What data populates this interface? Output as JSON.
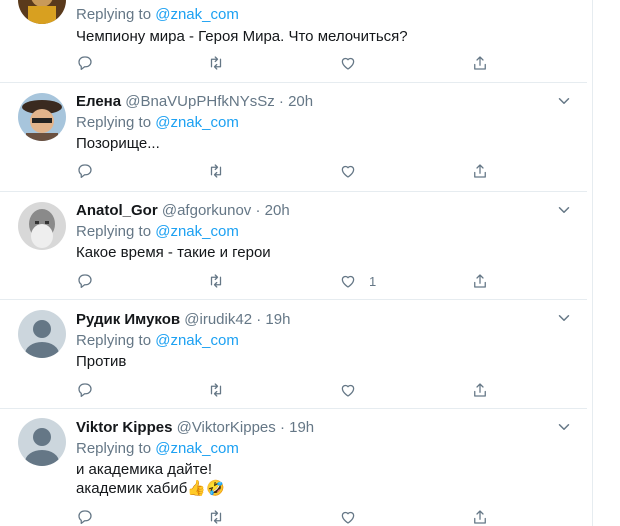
{
  "tweets": [
    {
      "name": "",
      "handle": "",
      "time": "",
      "replying_prefix": "Replying to ",
      "mention": "@znak_com",
      "lines": [
        "Чемпиону мира - Героя Мира. Что мелочиться?"
      ],
      "likes": ""
    },
    {
      "name": "Елена",
      "handle": "@BnaVUpPHfkNYsSz",
      "separator": "·",
      "time": "20h",
      "replying_prefix": "Replying to ",
      "mention": "@znak_com",
      "lines": [
        "Позорище..."
      ],
      "likes": ""
    },
    {
      "name": "Anatol_Gor",
      "handle": "@afgorkunov",
      "separator": "·",
      "time": "20h",
      "replying_prefix": "Replying to ",
      "mention": "@znak_com",
      "lines": [
        "Какое время - такие и герои"
      ],
      "likes": "1"
    },
    {
      "name": "Рудик Имуков",
      "handle": "@irudik42",
      "separator": "·",
      "time": "19h",
      "replying_prefix": "Replying to ",
      "mention": "@znak_com",
      "lines": [
        "Против"
      ],
      "likes": ""
    },
    {
      "name": "Viktor Kippes",
      "handle": "@ViktorKippes",
      "separator": "·",
      "time": "19h",
      "replying_prefix": "Replying to ",
      "mention": "@znak_com",
      "lines": [
        "и академика дайте!",
        "академик хабиб👍🤣"
      ],
      "likes": ""
    }
  ],
  "icons": {
    "reply": "reply-icon",
    "retweet": "retweet-icon",
    "like": "like-icon",
    "share": "share-icon",
    "more": "chevron-down-icon"
  },
  "colors": {
    "link": "#1da1f2",
    "muted": "#657786",
    "text": "#14171a",
    "border": "#e6ecf0"
  }
}
